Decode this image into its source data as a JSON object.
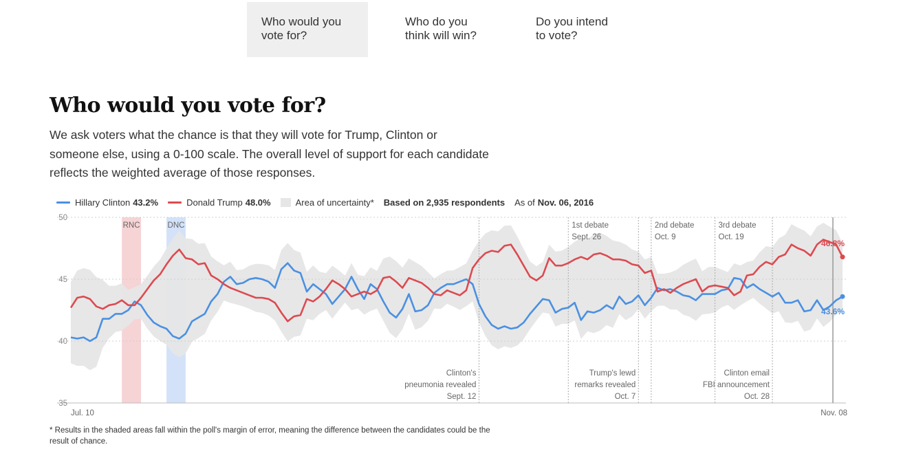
{
  "tabs": [
    {
      "line1": "Who would you",
      "line2": "vote for?",
      "active": true
    },
    {
      "line1": "Who do you",
      "line2": "think will win?",
      "active": false
    },
    {
      "line1": "Do you intend",
      "line2": "to vote?",
      "active": false
    }
  ],
  "heading": "Who would you vote for?",
  "description": "We ask voters what the chance is that they will vote for Trump, Clinton or someone else, using a 0-100 scale. The overall level of support for each candidate reflects the weighted average of those responses.",
  "legend": {
    "clinton_label": "Hillary Clinton",
    "clinton_value": "43.2%",
    "trump_label": "Donald Trump",
    "trump_value": "48.0%",
    "uncertainty_label": "Area of uncertainty*",
    "respondents": "Based on 2,935 respondents",
    "as_of_label": "As of",
    "as_of_date": "Nov. 06, 2016"
  },
  "footnote": "* Results in the shaded areas fall within the poll's margin of error, meaning the difference between the candidates could be the result of chance.",
  "colors": {
    "clinton": "#4a90e2",
    "trump": "#dc4a50",
    "band": "#e6e6e6",
    "rnc": "#f6d3d5",
    "dnc": "#d3e2f8"
  },
  "chart_data": {
    "type": "line",
    "x_start": "Jul. 10",
    "x_end": "Nov. 08",
    "n_points": 122,
    "ylim": [
      35,
      50
    ],
    "yticks": [
      35,
      40,
      45,
      50
    ],
    "grid": true,
    "conventions": [
      {
        "label": "RNC",
        "from_day": 8,
        "to_day": 11,
        "party": "rep"
      },
      {
        "label": "DNC",
        "from_day": 15,
        "to_day": 18,
        "party": "dem"
      }
    ],
    "events": [
      {
        "day": 64,
        "lines": [
          "Clinton's",
          "pneumonia revealed",
          "Sept. 12"
        ],
        "pos": "bottom"
      },
      {
        "day": 78,
        "lines": [
          "1st debate",
          "Sept. 26"
        ],
        "pos": "top"
      },
      {
        "day": 89,
        "lines": [
          "Trump's lewd",
          "remarks revealed",
          "Oct. 7"
        ],
        "pos": "bottom"
      },
      {
        "day": 91,
        "lines": [
          "2nd debate",
          "Oct. 9"
        ],
        "pos": "top"
      },
      {
        "day": 101,
        "lines": [
          "3rd debate",
          "Oct. 19"
        ],
        "pos": "top"
      },
      {
        "day": 110,
        "lines": [
          "Clinton email",
          "FBI announcement",
          "Oct. 28"
        ],
        "pos": "bottom"
      }
    ],
    "end_labels": {
      "trump": "46.8%",
      "clinton": "43.6%"
    },
    "series": [
      {
        "name": "Hillary Clinton",
        "key": "clinton",
        "values": [
          40.3,
          40.2,
          40.3,
          40.0,
          40.3,
          41.8,
          41.8,
          42.2,
          42.2,
          42.5,
          43.2,
          42.9,
          42.1,
          41.5,
          41.2,
          41.0,
          40.4,
          40.2,
          40.6,
          41.6,
          41.9,
          42.2,
          43.2,
          43.8,
          44.8,
          45.2,
          44.6,
          44.7,
          45.0,
          45.1,
          45.0,
          44.8,
          44.3,
          45.8,
          46.3,
          45.7,
          45.5,
          44.0,
          44.6,
          44.2,
          43.8,
          43.0,
          43.6,
          44.2,
          45.2,
          44.2,
          43.4,
          44.6,
          44.2,
          43.2,
          42.3,
          41.9,
          42.6,
          43.8,
          42.4,
          42.5,
          42.9,
          43.9,
          44.3,
          44.6,
          44.6,
          44.8,
          45.0,
          44.6,
          43.0,
          42.0,
          41.3,
          41.0,
          41.2,
          41.0,
          41.1,
          41.5,
          42.2,
          42.8,
          43.4,
          43.3,
          42.3,
          42.6,
          42.7,
          43.1,
          41.7,
          42.4,
          42.3,
          42.5,
          42.9,
          42.6,
          43.6,
          43.0,
          43.2,
          43.7,
          42.9,
          43.5,
          44.3,
          44.1,
          44.2,
          44.0,
          43.7,
          43.6,
          43.3,
          43.8,
          43.8,
          43.8,
          44.1,
          44.2,
          45.1,
          45.0,
          44.3,
          44.6,
          44.2,
          43.9,
          43.6,
          43.9,
          43.1,
          43.1,
          43.3,
          42.4,
          42.5,
          43.3,
          42.5,
          42.8,
          43.3,
          43.6
        ]
      },
      {
        "name": "Donald Trump",
        "key": "trump",
        "values": [
          42.7,
          43.5,
          43.6,
          43.4,
          42.8,
          42.6,
          42.9,
          43.0,
          43.3,
          42.9,
          42.9,
          43.5,
          44.2,
          44.9,
          45.4,
          46.2,
          46.9,
          47.4,
          46.7,
          46.6,
          46.2,
          46.3,
          45.3,
          45.0,
          44.6,
          44.3,
          44.1,
          43.9,
          43.7,
          43.5,
          43.5,
          43.4,
          43.1,
          42.3,
          41.6,
          42.0,
          42.1,
          43.4,
          43.2,
          43.6,
          44.2,
          44.9,
          44.6,
          44.2,
          43.6,
          43.8,
          44.0,
          43.8,
          44.1,
          45.1,
          45.2,
          44.8,
          44.3,
          45.1,
          44.9,
          44.7,
          44.3,
          43.8,
          43.7,
          44.1,
          43.9,
          43.7,
          44.1,
          45.9,
          46.6,
          47.1,
          47.3,
          47.2,
          47.7,
          47.8,
          47.0,
          46.1,
          45.2,
          44.9,
          45.3,
          46.7,
          46.1,
          46.1,
          46.3,
          46.6,
          46.8,
          46.6,
          47.0,
          47.1,
          46.9,
          46.6,
          46.6,
          46.5,
          46.2,
          46.1,
          45.5,
          45.7,
          44.0,
          44.2,
          43.9,
          44.3,
          44.6,
          44.8,
          45.0,
          44.0,
          44.4,
          44.5,
          44.4,
          44.3,
          43.7,
          44.0,
          45.3,
          45.4,
          46.0,
          46.4,
          46.2,
          46.8,
          47.0,
          47.8,
          47.5,
          47.3,
          46.9,
          47.8,
          48.2,
          48.0,
          47.8,
          46.8
        ]
      }
    ]
  }
}
